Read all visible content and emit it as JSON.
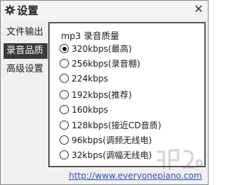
{
  "window": {
    "title": "设置",
    "title_icon": "gear-icon",
    "close_icon": "close-icon",
    "close_glyph": "✕"
  },
  "sidebar": {
    "items": [
      {
        "label": "文件输出",
        "active": false
      },
      {
        "label": "录音品质",
        "active": true
      },
      {
        "label": "高级设置",
        "active": false
      }
    ]
  },
  "quality": {
    "title": "mp3 录音质量",
    "selected": "320kbps(最高)",
    "options": [
      {
        "label": "320kbps(最高)",
        "checked": true
      },
      {
        "label": "256kbps(录音棚)",
        "checked": false
      },
      {
        "label": "224kbps",
        "checked": false
      },
      {
        "label": "192kbps(推荐)",
        "checked": false
      },
      {
        "label": "160kbps",
        "checked": false
      },
      {
        "label": "128kbps(接近CD音质)",
        "checked": false
      },
      {
        "label": "96kbps(调频无线电)",
        "checked": false
      },
      {
        "label": "32kbps(调幅无线电)",
        "checked": false
      }
    ]
  },
  "footer": {
    "link": "http://www.everyonepiano.com"
  },
  "watermark": {
    "icon": "watermark-logo-icon"
  }
}
